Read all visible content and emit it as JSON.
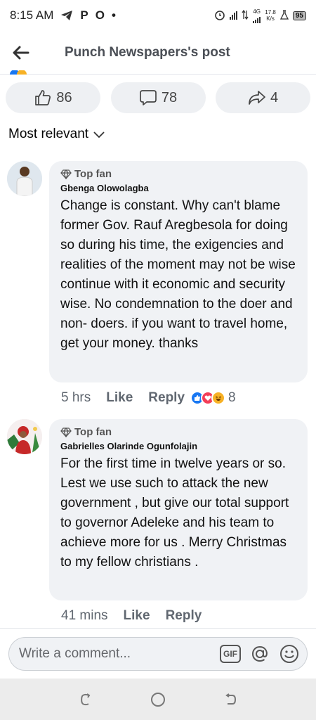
{
  "status_bar": {
    "time": "8:15 AM",
    "net_speed_value": "17.8",
    "net_speed_unit": "K/s",
    "network_type": "4G",
    "battery": "95"
  },
  "header": {
    "title": "Punch Newspapers's post"
  },
  "actions": {
    "likes": "86",
    "comments": "78",
    "shares": "4"
  },
  "sort": {
    "label": "Most relevant"
  },
  "comments": [
    {
      "badge": "Top fan",
      "author": "Gbenga Olowolagba",
      "text": "Change is constant. Why can't blame former Gov. Rauf Aregbesola for doing so during his time, the exigencies and realities of the moment may not be wise continue with it economic and security wise. No condemnation to the doer and non- doers. if you want to travel home, get your money. thanks",
      "time": "5 hrs",
      "like_label": "Like",
      "reply_label": "Reply",
      "reaction_count": "8"
    },
    {
      "badge": "Top fan",
      "author": "Gabrielles Olarinde Ogunfolajin",
      "text": "For the first time in twelve years or so. Lest we use such to attack the new government , but give our total support to governor Adeleke and his team to achieve more for us . Merry Christmas to my fellow christians .",
      "time": "41 mins",
      "like_label": "Like",
      "reply_label": "Reply"
    }
  ],
  "composer": {
    "placeholder": "Write a comment...",
    "gif_label": "GIF"
  },
  "colors": {
    "like_blue": "#1877f2",
    "love_red": "#f33e58",
    "haha_yellow": "#f7b125",
    "pill_bg": "#eef0f3",
    "bubble_bg": "#f0f2f5"
  }
}
